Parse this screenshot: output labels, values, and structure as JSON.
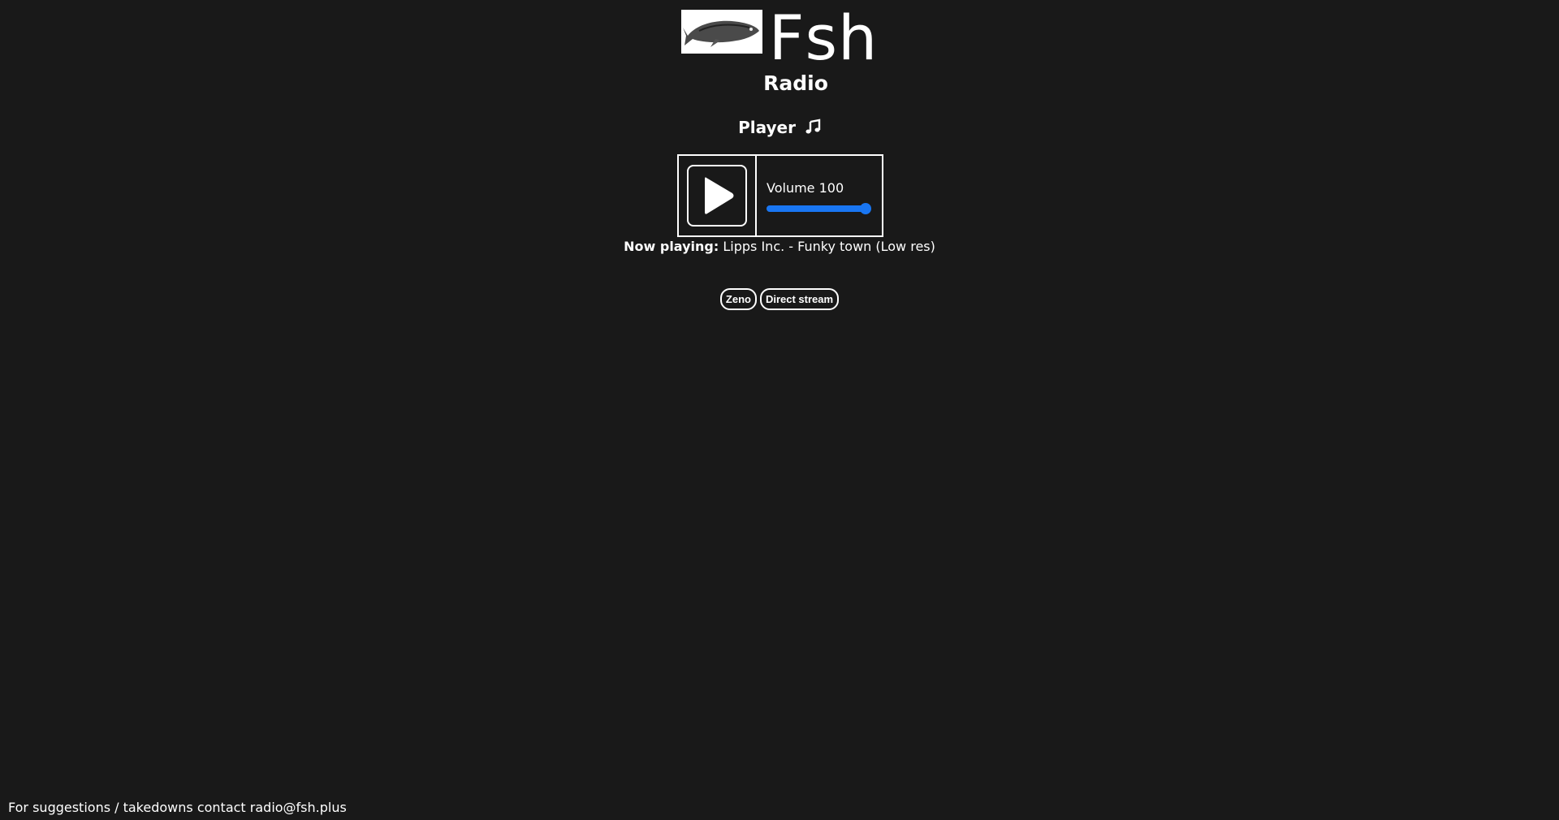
{
  "brand": {
    "name": "Fsh",
    "subtitle": "Radio",
    "logo_icon": "fish-icon"
  },
  "player": {
    "title": "Player",
    "title_icon": "music-note-icon",
    "play_icon": "play-icon",
    "volume_label": "Volume 100",
    "volume_value": 100,
    "accent_color": "#1976f2"
  },
  "now_playing": {
    "label": "Now playing:",
    "track": "Lipps Inc. - Funky town (Low res)"
  },
  "links": [
    {
      "label": "Zeno"
    },
    {
      "label": "Direct stream"
    }
  ],
  "footer": {
    "text": "For suggestions / takedowns contact radio@fsh.plus"
  },
  "colors": {
    "background": "#191919",
    "text": "#ffffff"
  }
}
